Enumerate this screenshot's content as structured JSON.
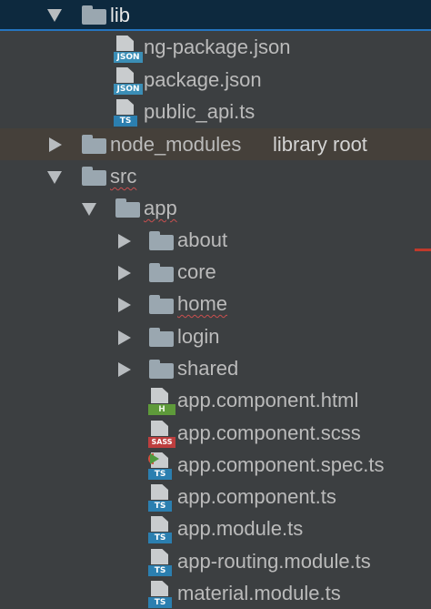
{
  "tree": {
    "lib": {
      "label": "lib"
    },
    "lib_files": [
      {
        "label": "ng-package.json",
        "badge": "JSON"
      },
      {
        "label": "package.json",
        "badge": "JSON"
      },
      {
        "label": "public_api.ts",
        "badge": "TS"
      }
    ],
    "node_modules": {
      "label": "node_modules",
      "suffix": "library root"
    },
    "src": {
      "label": "src"
    },
    "app": {
      "label": "app"
    },
    "app_folders": [
      {
        "label": "about"
      },
      {
        "label": "core"
      },
      {
        "label": "home"
      },
      {
        "label": "login"
      },
      {
        "label": "shared"
      }
    ],
    "app_files": [
      {
        "label": "app.component.html",
        "badge": "H"
      },
      {
        "label": "app.component.scss",
        "badge": "SASS"
      },
      {
        "label": "app.component.spec.ts",
        "badge": "TS"
      },
      {
        "label": "app.component.ts",
        "badge": "TS"
      },
      {
        "label": "app.module.ts",
        "badge": "TS"
      },
      {
        "label": "app-routing.module.ts",
        "badge": "TS"
      },
      {
        "label": "material.module.ts",
        "badge": "TS"
      }
    ]
  },
  "colors": {
    "background": "#3c3f41",
    "selection": "#0d293e",
    "library_root_bg": "#45403a",
    "folder": "#9aa7b0",
    "json_badge": "#3b8eb6",
    "ts_badge": "#2b7fb0",
    "html_badge": "#5e9a3a",
    "sass_badge": "#bd3e3e",
    "error_underline": "#c94f4f"
  },
  "icons": {
    "expanded": "chevron-down-icon",
    "collapsed": "chevron-right-icon",
    "folder": "folder-icon",
    "json_file": "json-file-icon",
    "ts_file": "typescript-file-icon",
    "html_file": "html-file-icon",
    "sass_file": "sass-file-icon"
  }
}
